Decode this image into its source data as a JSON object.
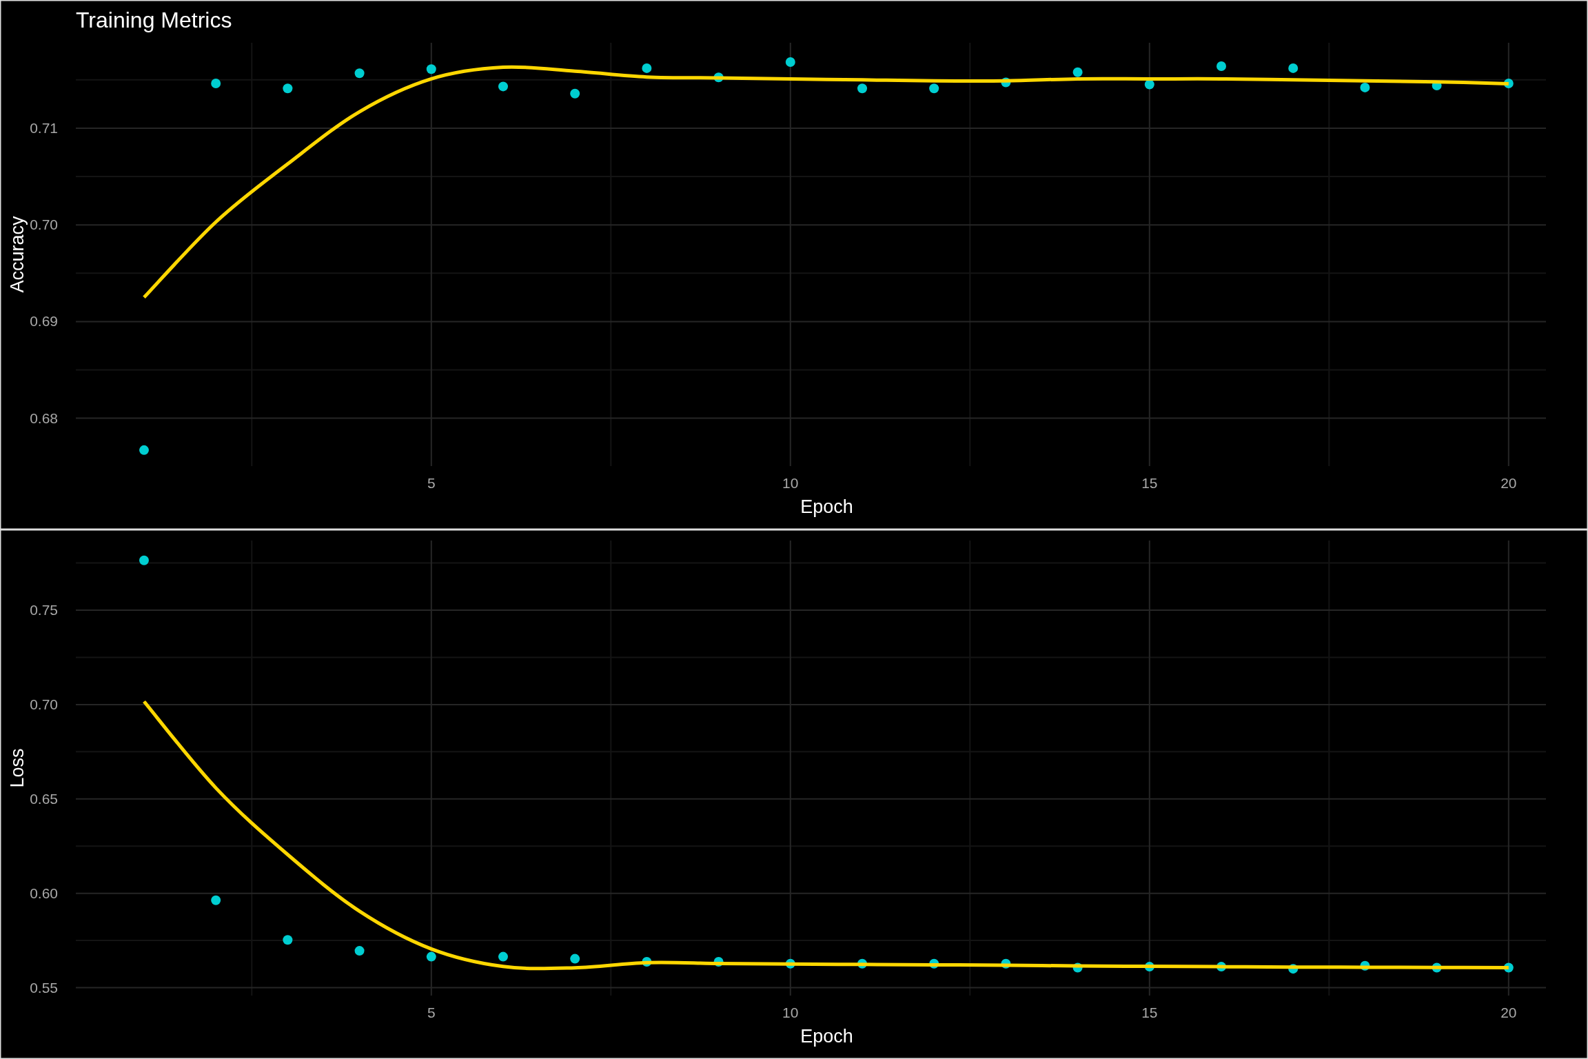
{
  "charts": [
    {
      "chart_data": {
        "type": "scatter",
        "grid": true,
        "title": "Training Metrics",
        "xlabel": "Epoch",
        "ylabel": "Accuracy",
        "x": [
          1,
          2,
          3,
          4,
          5,
          6,
          7,
          8,
          9,
          10,
          11,
          12,
          13,
          14,
          15,
          16,
          17,
          18,
          19,
          20
        ],
        "xlim": [
          0.05,
          20.52
        ],
        "ylim": [
          0.67505,
          0.71884
        ],
        "xticks": [
          5,
          10,
          15,
          20
        ],
        "yticks": [
          {
            "value": 0.68,
            "label": "0.68"
          },
          {
            "value": 0.69,
            "label": "0.69"
          },
          {
            "value": 0.7,
            "label": "0.70"
          },
          {
            "value": 0.71,
            "label": "0.71"
          }
        ],
        "series": [
          {
            "type": "scatter",
            "color": "#00ced1",
            "values": [
              0.6767,
              0.71463,
              0.71411,
              0.71568,
              0.71611,
              0.71432,
              0.71358,
              0.71621,
              0.71526,
              0.71684,
              0.71411,
              0.71411,
              0.71474,
              0.71579,
              0.71453,
              0.71642,
              0.71621,
              0.71421,
              0.71442,
              0.71463
            ]
          },
          {
            "type": "line",
            "color": "#ffd700",
            "values": [
              0.6925,
              0.7003,
              0.7063,
              0.7117,
              0.7151,
              0.7163,
              0.7159,
              0.7153,
              0.7152,
              0.7151,
              0.715,
              0.7149,
              0.7149,
              0.7151,
              0.7151,
              0.7151,
              0.715,
              0.7149,
              0.7148,
              0.7146
            ]
          }
        ]
      }
    },
    {
      "chart_data": {
        "type": "scatter",
        "grid": true,
        "xlabel": "Epoch",
        "ylabel": "Loss",
        "x": [
          1,
          2,
          3,
          4,
          5,
          6,
          7,
          8,
          9,
          10,
          11,
          12,
          13,
          14,
          15,
          16,
          17,
          18,
          19,
          20
        ],
        "xlim": [
          0.05,
          20.52
        ],
        "ylim": [
          0.5458,
          0.7869
        ],
        "xticks": [
          5,
          10,
          15,
          20
        ],
        "yticks": [
          {
            "value": 0.55,
            "label": "0.55"
          },
          {
            "value": 0.6,
            "label": "0.60"
          },
          {
            "value": 0.65,
            "label": "0.65"
          },
          {
            "value": 0.7,
            "label": "0.70"
          },
          {
            "value": 0.75,
            "label": "0.75"
          }
        ],
        "series": [
          {
            "type": "scatter",
            "color": "#00ced1",
            "values": [
              0.7764,
              0.5963,
              0.5753,
              0.5695,
              0.5664,
              0.5664,
              0.5653,
              0.5637,
              0.5637,
              0.5627,
              0.5627,
              0.5627,
              0.5627,
              0.5606,
              0.5611,
              0.5611,
              0.56,
              0.5616,
              0.5606,
              0.5606
            ]
          },
          {
            "type": "line",
            "color": "#ffd700",
            "values": [
              0.7016,
              0.6558,
              0.6205,
              0.5905,
              0.5705,
              0.5612,
              0.5605,
              0.5632,
              0.5628,
              0.5625,
              0.5623,
              0.5621,
              0.5619,
              0.5615,
              0.5613,
              0.5611,
              0.5609,
              0.5608,
              0.5607,
              0.5606
            ]
          }
        ]
      }
    }
  ]
}
